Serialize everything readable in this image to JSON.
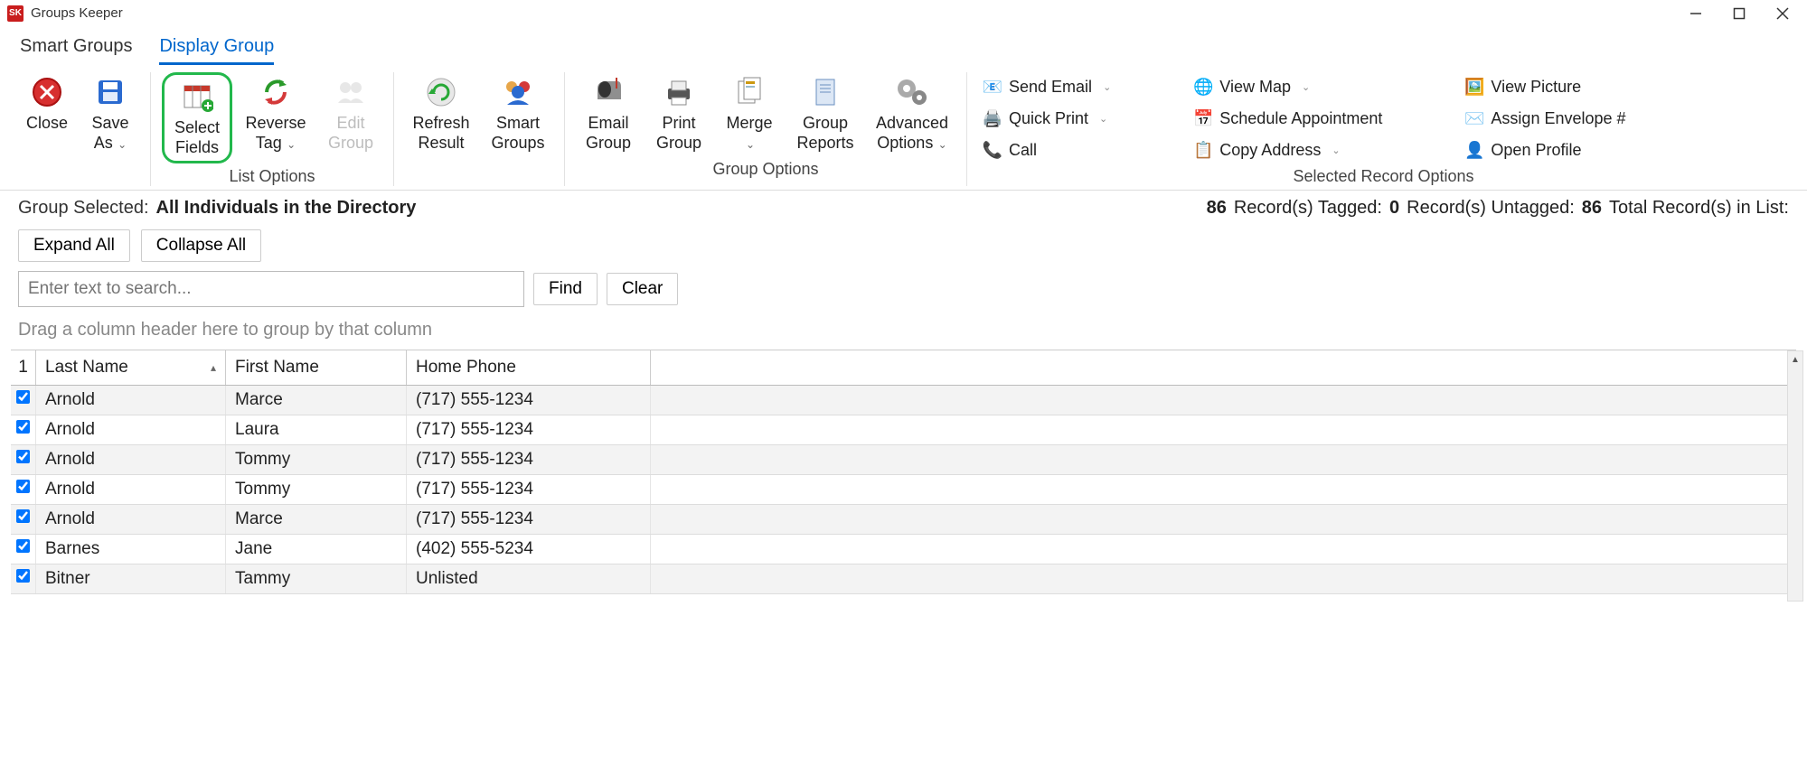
{
  "window": {
    "title": "Groups Keeper"
  },
  "tabs": {
    "smart": "Smart Groups",
    "display": "Display Group"
  },
  "ribbon": {
    "close": "Close",
    "saveas": "Save\nAs",
    "selectfields": "Select\nFields",
    "reversetag": "Reverse\nTag",
    "editgroup": "Edit\nGroup",
    "refresh": "Refresh\nResult",
    "smartgroups": "Smart\nGroups",
    "emailgroup": "Email\nGroup",
    "printgroup": "Print\nGroup",
    "merge": "Merge",
    "groupreports": "Group\nReports",
    "advanced": "Advanced\nOptions",
    "group_list_options": "List Options",
    "group_group_options": "Group Options",
    "group_selected_options": "Selected Record Options",
    "side": {
      "send_email": "Send Email",
      "quick_print": "Quick Print",
      "call": "Call",
      "view_map": "View Map",
      "schedule": "Schedule Appointment",
      "copy_address": "Copy Address",
      "view_picture": "View Picture",
      "assign_envelope": "Assign Envelope #",
      "open_profile": "Open Profile"
    }
  },
  "status": {
    "group_selected_label": "Group Selected:",
    "group_selected_value": "All Individuals in the Directory",
    "tagged_count": "86",
    "tagged_label": "Record(s) Tagged:",
    "untagged_count": "0",
    "untagged_label": "Record(s)  Untagged:",
    "total_count": "86",
    "total_label": "Total Record(s) in List:"
  },
  "buttons": {
    "expand": "Expand All",
    "collapse": "Collapse All",
    "find": "Find",
    "clear": "Clear"
  },
  "search": {
    "placeholder": "Enter text to search..."
  },
  "group_hint": "Drag a column header here to group by that column",
  "columns": {
    "chk": "1",
    "last": "Last Name",
    "first": "First Name",
    "phone": "Home Phone"
  },
  "rows": [
    {
      "last": "Arnold",
      "first": "Marce",
      "phone": "(717) 555-1234"
    },
    {
      "last": "Arnold",
      "first": "Laura",
      "phone": "(717) 555-1234"
    },
    {
      "last": "Arnold",
      "first": "Tommy",
      "phone": "(717) 555-1234"
    },
    {
      "last": "Arnold",
      "first": "Tommy",
      "phone": "(717) 555-1234"
    },
    {
      "last": "Arnold",
      "first": "Marce",
      "phone": "(717) 555-1234"
    },
    {
      "last": "Barnes",
      "first": "Jane",
      "phone": "(402) 555-5234"
    },
    {
      "last": "Bitner",
      "first": "Tammy",
      "phone": "Unlisted"
    }
  ]
}
